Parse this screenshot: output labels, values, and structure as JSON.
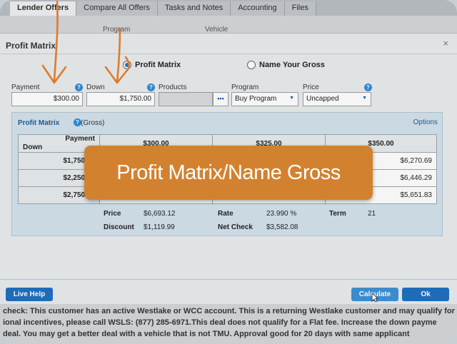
{
  "tabs": [
    "Lender Offers",
    "Compare All Offers",
    "Tasks and Notes",
    "Accounting",
    "Files"
  ],
  "ghost_headers": [
    "Program",
    "Vehicle"
  ],
  "modal": {
    "title": "Profit Matrix",
    "close": "×"
  },
  "mode": {
    "profit_matrix": "Profit Matrix",
    "name_your_gross": "Name Your Gross",
    "selected": "profit_matrix"
  },
  "fields": {
    "payment_label": "Payment",
    "payment_value": "$300.00",
    "down_label": "Down",
    "down_value": "$1,750.00",
    "products_label": "Products",
    "products_value": "",
    "products_button": "•••",
    "program_label": "Program",
    "program_value": "Buy Program",
    "price_label": "Price",
    "price_value": "Uncapped",
    "help": "?"
  },
  "matrix": {
    "title": "Profit Matrix",
    "subtitle": "(Gross)",
    "options": "Options",
    "corner_payment": "Payment",
    "corner_down": "Down",
    "payments": [
      "$300.00",
      "$325.00",
      "$350.00"
    ],
    "rows": [
      {
        "down": "$1,750.00",
        "cells": [
          "",
          "",
          "$6,270.69"
        ]
      },
      {
        "down": "$2,250.00",
        "cells": [
          "",
          "",
          "$6,446.29"
        ]
      },
      {
        "down": "$2,750.00",
        "cells": [
          "",
          "",
          "$5,651.83"
        ]
      }
    ]
  },
  "summary": {
    "price_label": "Price",
    "price_value": "$6,693.12",
    "rate_label": "Rate",
    "rate_value": "23.990 %",
    "term_label": "Term",
    "term_value": "21",
    "discount_label": "Discount",
    "discount_value": "$1,119.99",
    "netcheck_label": "Net Check",
    "netcheck_value": "$3,582.08"
  },
  "buttons": {
    "live_help": "Live Help",
    "calculate": "Calculate",
    "ok": "Ok"
  },
  "bottom_text": [
    "check: This customer has an active Westlake or WCC account. This is a returning Westlake customer and may qualify for",
    "ional incentives, please call WSLS: (877) 285-6971.This deal does not qualify for a Flat fee. Increase the down payme",
    "deal. You may get a better deal with a vehicle that is not TMU. Approval good for 20 days with same applicant"
  ],
  "banner": "Profit Matrix/Name Gross",
  "colors": {
    "accent": "#1d6fbf",
    "banner": "#d2822f",
    "annotation_arrow": "#e07a2a"
  }
}
